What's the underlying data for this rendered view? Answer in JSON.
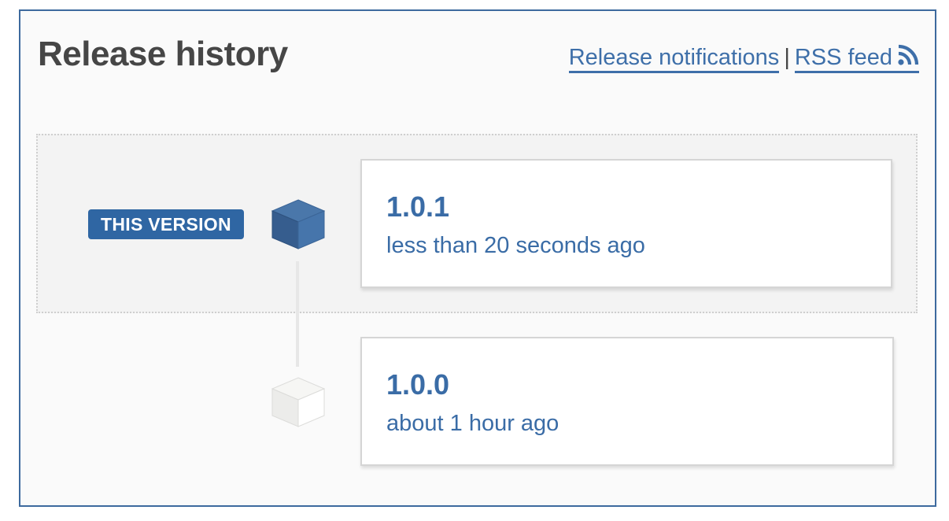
{
  "header": {
    "title": "Release history",
    "notifications_link": "Release notifications",
    "separator": "|",
    "rss_link": "RSS feed",
    "rss_icon": "rss-icon"
  },
  "current_badge": "THIS VERSION",
  "releases": [
    {
      "version": "1.0.1",
      "date": "less than 20 seconds ago",
      "is_current": true,
      "icon": "package-cube-icon"
    },
    {
      "version": "1.0.0",
      "date": "about 1 hour ago",
      "is_current": false,
      "icon": "package-cube-icon"
    }
  ],
  "colors": {
    "accent": "#3a6ca6",
    "badge_bg": "#2f66a3",
    "border": "#3d6a9e",
    "title_text": "#464646"
  }
}
